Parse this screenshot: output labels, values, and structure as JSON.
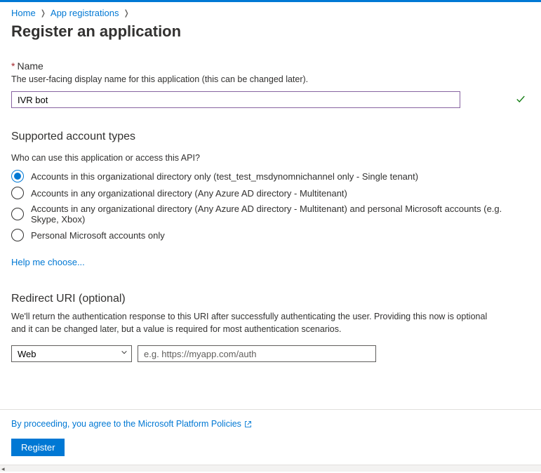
{
  "breadcrumb": {
    "items": [
      "Home",
      "App registrations"
    ]
  },
  "page": {
    "title": "Register an application"
  },
  "name_section": {
    "label": "Name",
    "description": "The user-facing display name for this application (this can be changed later).",
    "value": "IVR bot"
  },
  "account_types": {
    "heading": "Supported account types",
    "question": "Who can use this application or access this API?",
    "options": [
      {
        "label": "Accounts in this organizational directory only (test_test_msdynomnichannel only - Single tenant)",
        "selected": true
      },
      {
        "label": "Accounts in any organizational directory (Any Azure AD directory - Multitenant)",
        "selected": false
      },
      {
        "label": "Accounts in any organizational directory (Any Azure AD directory - Multitenant) and personal Microsoft accounts (e.g. Skype, Xbox)",
        "selected": false
      },
      {
        "label": "Personal Microsoft accounts only",
        "selected": false
      }
    ],
    "help_link": "Help me choose..."
  },
  "redirect": {
    "heading": "Redirect URI (optional)",
    "description": "We'll return the authentication response to this URI after successfully authenticating the user. Providing this now is optional and it can be changed later, but a value is required for most authentication scenarios.",
    "platform_selected": "Web",
    "uri_placeholder": "e.g. https://myapp.com/auth"
  },
  "footer": {
    "policy_text": "By proceeding, you agree to the Microsoft Platform Policies",
    "register_label": "Register"
  }
}
